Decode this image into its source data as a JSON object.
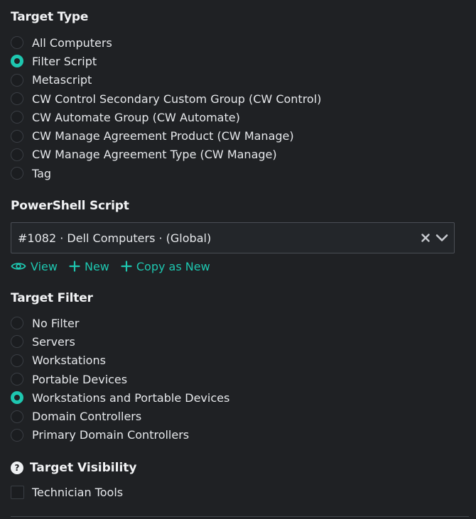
{
  "target_type": {
    "title": "Target Type",
    "options": [
      {
        "label": "All Computers",
        "checked": false
      },
      {
        "label": "Filter Script",
        "checked": true
      },
      {
        "label": "Metascript",
        "checked": false
      },
      {
        "label": "CW Control Secondary Custom Group (CW Control)",
        "checked": false
      },
      {
        "label": "CW Automate Group (CW Automate)",
        "checked": false
      },
      {
        "label": "CW Manage Agreement Product (CW Manage)",
        "checked": false
      },
      {
        "label": "CW Manage Agreement Type (CW Manage)",
        "checked": false
      },
      {
        "label": "Tag",
        "checked": false
      }
    ]
  },
  "powershell": {
    "title": "PowerShell Script",
    "selected_value": "#1082 · Dell Computers · (Global)",
    "actions": {
      "view": "View",
      "new": "New",
      "copy_as_new": "Copy as New"
    }
  },
  "target_filter": {
    "title": "Target Filter",
    "options": [
      {
        "label": "No Filter",
        "checked": false
      },
      {
        "label": "Servers",
        "checked": false
      },
      {
        "label": "Workstations",
        "checked": false
      },
      {
        "label": "Portable Devices",
        "checked": false
      },
      {
        "label": "Workstations and Portable Devices",
        "checked": true
      },
      {
        "label": "Domain Controllers",
        "checked": false
      },
      {
        "label": "Primary Domain Controllers",
        "checked": false
      }
    ]
  },
  "target_visibility": {
    "title": "Target Visibility",
    "help_icon": "?",
    "checkbox_label": "Technician Tools",
    "checkbox_checked": false
  },
  "colors": {
    "accent": "#1ec7b0",
    "background": "#1f2124"
  }
}
